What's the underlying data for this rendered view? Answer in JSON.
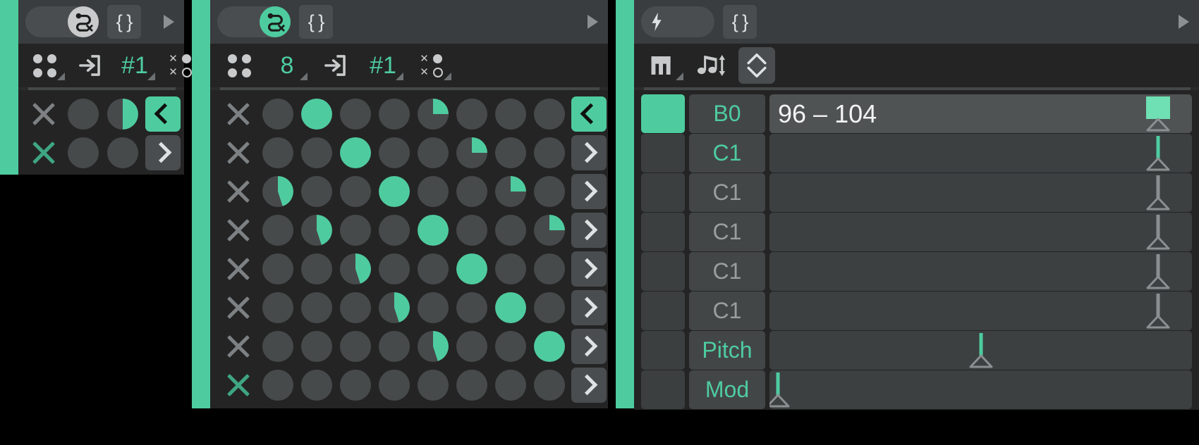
{
  "theme": {
    "accent": "#4ecca0",
    "accent_dark": "#3fa583",
    "bg": "#000000",
    "panel_bg": "#2b2b2b",
    "toolbar_bg": "#242424",
    "titlebar_bg": "#3a3d3f",
    "knob_off": "#474a4b",
    "text_light": "#dfe2e3",
    "text_dim": "#9b9e9f"
  },
  "panels": {
    "left": {
      "name": "mutate-panel",
      "titlebar": {
        "toggle_icon": "snake-loop-x-icon",
        "toggle_state": "off",
        "brace_label": "{ }",
        "play_icon": "play-triangle-icon"
      },
      "toolbar": [
        {
          "name": "four-dots-icon",
          "icon": "four-dots-icon",
          "label": "",
          "has_corner": true
        },
        {
          "name": "enter-box-icon",
          "icon": "enter-box-icon",
          "label": ""
        },
        {
          "name": "preset-number",
          "icon": "",
          "label": "#1",
          "has_corner": true
        },
        {
          "name": "x-dot-matrix-icon",
          "icon": "x-dot-matrix-icon",
          "label": "",
          "has_corner": true
        }
      ],
      "rows": [
        {
          "x_active": false,
          "knobs": [
            0,
            50
          ],
          "arrow": "left",
          "arrow_on": true
        },
        {
          "x_active": true,
          "knobs": [
            0,
            0
          ],
          "arrow": "right",
          "arrow_on": false
        }
      ]
    },
    "middle": {
      "name": "euclid-sequencer-panel",
      "titlebar": {
        "toggle_icon": "snake-loop-x-icon",
        "toggle_state": "on",
        "brace_label": "{ }",
        "play_icon": "play-triangle-icon"
      },
      "toolbar": [
        {
          "name": "four-dots-icon",
          "icon": "four-dots-icon",
          "label": ""
        },
        {
          "name": "step-count",
          "icon": "",
          "label": "8",
          "has_corner": true
        },
        {
          "name": "enter-box-icon",
          "icon": "enter-box-icon",
          "label": ""
        },
        {
          "name": "preset-number",
          "icon": "",
          "label": "#1",
          "has_corner": true
        },
        {
          "name": "x-dot-matrix-icon",
          "icon": "x-dot-matrix-icon",
          "label": "",
          "has_corner": true
        }
      ],
      "columns": 8,
      "rows": [
        {
          "x_active": false,
          "knobs": [
            0,
            100,
            0,
            0,
            25,
            0,
            0,
            0
          ],
          "arrow": "left",
          "arrow_on": true
        },
        {
          "x_active": false,
          "knobs": [
            0,
            0,
            100,
            0,
            0,
            25,
            0,
            0
          ],
          "arrow": "right",
          "arrow_on": false
        },
        {
          "x_active": false,
          "knobs": [
            45,
            0,
            0,
            100,
            0,
            0,
            25,
            0
          ],
          "arrow": "right",
          "arrow_on": false
        },
        {
          "x_active": false,
          "knobs": [
            0,
            45,
            0,
            0,
            100,
            0,
            0,
            25
          ],
          "arrow": "right",
          "arrow_on": false
        },
        {
          "x_active": false,
          "knobs": [
            0,
            0,
            45,
            0,
            0,
            100,
            0,
            0
          ],
          "arrow": "right",
          "arrow_on": false
        },
        {
          "x_active": false,
          "knobs": [
            0,
            0,
            0,
            45,
            0,
            0,
            100,
            0
          ],
          "arrow": "right",
          "arrow_on": false
        },
        {
          "x_active": false,
          "knobs": [
            0,
            0,
            0,
            0,
            45,
            0,
            0,
            100
          ],
          "arrow": "right",
          "arrow_on": false
        },
        {
          "x_active": true,
          "knobs": [
            0,
            0,
            0,
            0,
            0,
            0,
            0,
            0
          ],
          "arrow": "right",
          "arrow_on": false
        }
      ]
    },
    "right": {
      "name": "note-lanes-panel",
      "titlebar": {
        "toggle_icon": "lightning-bolt-icon",
        "toggle_state": "off",
        "brace_label": "{ }",
        "play_icon": "play-triangle-icon"
      },
      "toolbar": [
        {
          "name": "piano-keys-icon",
          "icon": "piano-keys-icon",
          "label": "",
          "has_corner": true
        },
        {
          "name": "note-transpose-icon",
          "icon": "note-transpose-icon",
          "label": ""
        },
        {
          "name": "updown-chevrons-button",
          "icon": "chevron-updown-icon",
          "label": "",
          "boxed": true
        }
      ],
      "rows": [
        {
          "swatch_on": true,
          "note": "B0",
          "note_accent": true,
          "value": "96 – 104",
          "highlight": true,
          "marker": 92,
          "marker_kind": "block"
        },
        {
          "swatch_on": false,
          "note": "C1",
          "note_accent": true,
          "value": "",
          "highlight": false,
          "marker": 92,
          "marker_kind": "accent"
        },
        {
          "swatch_on": false,
          "note": "C1",
          "note_accent": false,
          "value": "",
          "highlight": false,
          "marker": 92,
          "marker_kind": "gray"
        },
        {
          "swatch_on": false,
          "note": "C1",
          "note_accent": false,
          "value": "",
          "highlight": false,
          "marker": 92,
          "marker_kind": "gray"
        },
        {
          "swatch_on": false,
          "note": "C1",
          "note_accent": false,
          "value": "",
          "highlight": false,
          "marker": 92,
          "marker_kind": "gray"
        },
        {
          "swatch_on": false,
          "note": "C1",
          "note_accent": false,
          "value": "",
          "highlight": false,
          "marker": 92,
          "marker_kind": "gray"
        },
        {
          "swatch_on": false,
          "note": "Pitch",
          "note_accent": true,
          "value": "",
          "highlight": false,
          "marker": 50,
          "marker_kind": "accent"
        },
        {
          "swatch_on": false,
          "note": "Mod",
          "note_accent": true,
          "value": "",
          "highlight": false,
          "marker": 2,
          "marker_kind": "accent"
        }
      ]
    }
  }
}
